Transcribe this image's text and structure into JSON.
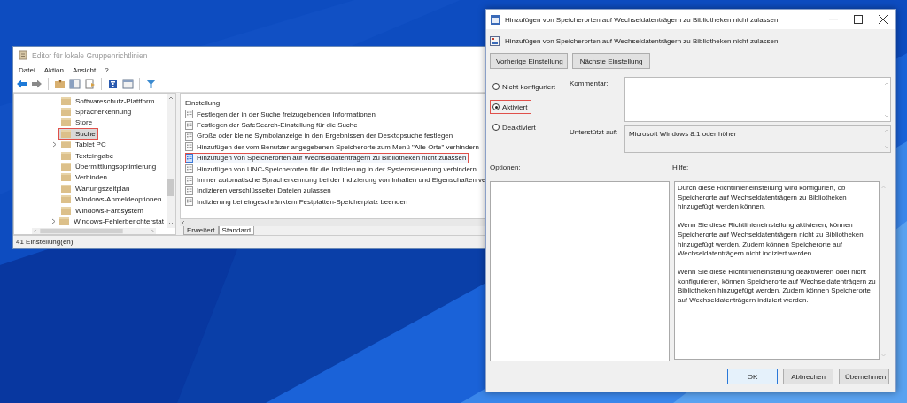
{
  "editor": {
    "title": "Editor für lokale Gruppenrichtlinien",
    "menu": [
      "Datei",
      "Aktion",
      "Ansicht",
      "?"
    ],
    "tree": [
      {
        "label": "Softwareschutz-Plattform",
        "expandable": false,
        "selected": false,
        "marked": false
      },
      {
        "label": "Spracherkennung",
        "expandable": false,
        "selected": false,
        "marked": false
      },
      {
        "label": "Store",
        "expandable": false,
        "selected": false,
        "marked": false
      },
      {
        "label": "Suche",
        "expandable": false,
        "selected": true,
        "marked": true
      },
      {
        "label": "Tablet PC",
        "expandable": true,
        "selected": false,
        "marked": false
      },
      {
        "label": "Texteingabe",
        "expandable": false,
        "selected": false,
        "marked": false
      },
      {
        "label": "Übermittlungsoptimierung",
        "expandable": false,
        "selected": false,
        "marked": false
      },
      {
        "label": "Verbinden",
        "expandable": false,
        "selected": false,
        "marked": false
      },
      {
        "label": "Wartungszeitplan",
        "expandable": false,
        "selected": false,
        "marked": false
      },
      {
        "label": "Windows-Anmeldeoptionen",
        "expandable": false,
        "selected": false,
        "marked": false
      },
      {
        "label": "Windows-Farbsystem",
        "expandable": false,
        "selected": false,
        "marked": false
      },
      {
        "label": "Windows-Fehlerberichterstat",
        "expandable": true,
        "selected": false,
        "marked": false
      }
    ],
    "list": {
      "column": "Einstellung",
      "rows": [
        {
          "label": "Festlegen der in der Suche freizugebenden Informationen",
          "selected": false,
          "marked": false
        },
        {
          "label": "Festlegen der SafeSearch-Einstellung für die Suche",
          "selected": false,
          "marked": false
        },
        {
          "label": "Große oder kleine Symbolanzeige in den Ergebnissen der Desktopsuche festlegen",
          "selected": false,
          "marked": false
        },
        {
          "label": "Hinzufügen der vom Benutzer angegebenen Speicherorte zum Menü \"Alle Orte\" verhindern",
          "selected": false,
          "marked": false
        },
        {
          "label": "Hinzufügen von Speicherorten auf Wechseldatenträgern zu Bibliotheken nicht zulassen",
          "selected": true,
          "marked": true
        },
        {
          "label": "Hinzufügen von UNC-Speicherorten für die Indizierung in der Systemsteuerung verhindern",
          "selected": false,
          "marked": false
        },
        {
          "label": "Immer automatische Spracherkennung bei der Indizierung von Inhalten und Eigenschaften ve",
          "selected": false,
          "marked": false
        },
        {
          "label": "Indizieren verschlüsselter Dateien zulassen",
          "selected": false,
          "marked": false
        },
        {
          "label": "Indizierung bei eingeschränktem Festplatten-Speicherplatz beenden",
          "selected": false,
          "marked": false
        }
      ]
    },
    "tabs": [
      {
        "label": "Erweitert",
        "selected": false
      },
      {
        "label": "Standard",
        "selected": true
      }
    ],
    "status_bar": "41 Einstellung(en)"
  },
  "dialog": {
    "title": "Hinzufügen von Speicherorten auf Wechseldatenträgern zu Bibliotheken nicht zulassen",
    "setting_title": "Hinzufügen von Speicherorten auf Wechseldatenträgern zu Bibliotheken nicht zulassen",
    "nav_buttons": [
      "Vorherige Einstellung",
      "Nächste Einstellung"
    ],
    "options": [
      {
        "label": "Nicht konfiguriert",
        "selected": false,
        "marked": false
      },
      {
        "label": "Aktiviert",
        "selected": true,
        "marked": true
      },
      {
        "label": "Deaktiviert",
        "selected": false,
        "marked": false
      }
    ],
    "comment": {
      "label": "Kommentar:"
    },
    "supported_on": {
      "label": "Unterstützt auf:",
      "value": "Microsoft Windows 8.1 oder höher"
    },
    "options_label": "Optionen:",
    "help_label": "Hilfe:",
    "help_text": [
      "Durch diese Richtlinieneinstellung wird konfiguriert, ob Speicherorte auf Wechseldatenträgern zu Bibliotheken hinzugefügt werden können.",
      "Wenn Sie diese Richtlinieneinstellung aktivieren, können Speicherorte auf Wechseldatenträgern nicht zu Bibliotheken hinzugefügt werden.  Zudem können Speicherorte auf Wechseldatenträgern nicht indiziert werden.",
      "Wenn Sie diese Richtlinieneinstellung deaktivieren oder nicht konfigurieren, können Speicherorte auf Wechseldatenträgern zu Bibliotheken hinzugefügt werden.  Zudem können Speicherorte auf Wechseldatenträgern indiziert werden."
    ],
    "buttons": [
      {
        "label": "OK",
        "default": true
      },
      {
        "label": "Abbrechen",
        "default": false
      },
      {
        "label": "Übernehmen",
        "default": false
      }
    ]
  }
}
